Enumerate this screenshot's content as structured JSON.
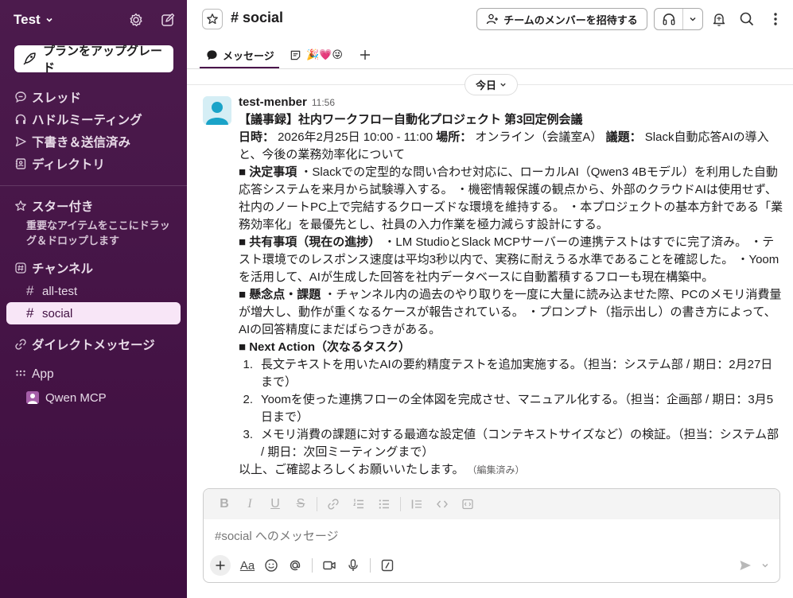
{
  "workspace": {
    "name": "Test",
    "upgrade_label": "プランをアップグレード"
  },
  "sidebar": {
    "nav": [
      {
        "icon": "threads-icon",
        "label": "スレッド"
      },
      {
        "icon": "headphones-icon",
        "label": "ハドルミーティング"
      },
      {
        "icon": "send-icon",
        "label": "下書き＆送信済み"
      },
      {
        "icon": "directory-icon",
        "label": "ディレクトリ"
      }
    ],
    "starred": {
      "label": "スター付き",
      "note": "重要なアイテムをここにドラッグ＆ドロップします"
    },
    "channels": {
      "label": "チャンネル",
      "items": [
        {
          "name": "all-test"
        },
        {
          "name": "social",
          "active": true
        }
      ]
    },
    "dms": {
      "label": "ダイレクトメッセージ"
    },
    "apps": {
      "label": "App",
      "items": [
        {
          "name": "Qwen MCP"
        }
      ]
    }
  },
  "header": {
    "channel": "social",
    "invite_label": "チームのメンバーを招待する",
    "tabs": [
      {
        "label": "メッセージ",
        "active": true
      },
      {
        "label": "🎉💗😜"
      }
    ]
  },
  "date_divider": "今日",
  "message": {
    "author": "test-menber",
    "time": "11:56",
    "title": "【議事録】社内ワークフロー自動化プロジェクト 第3回定例会議",
    "meta": {
      "date_label": "日時：",
      "date_value": " 2026年2月25日 10:00 - 11:00 ",
      "place_label": "場所：",
      "place_value": " オンライン（会議室A） ",
      "topic_label": "議題：",
      "topic_value": " Slack自動応答AIの導入と、今後の業務効率化について"
    },
    "sections": [
      {
        "heading": "■ 決定事項",
        "body": " ・Slackでの定型的な問い合わせ対応に、ローカルAI（Qwen3 4Bモデル）を利用した自動応答システムを来月から試験導入する。 ・機密情報保護の観点から、外部のクラウドAIは使用せず、社内のノートPC上で完結するクローズドな環境を維持する。 ・本プロジェクトの基本方針である「業務効率化」を最優先とし、社員の入力作業を極力減らす設計にする。"
      },
      {
        "heading": "■ 共有事項（現在の進捗）",
        "body": " ・LM StudioとSlack MCPサーバーの連携テストはすでに完了済み。 ・テスト環境でのレスポンス速度は平均3秒以内で、実務に耐えうる水準であることを確認した。 ・Yoomを活用して、AIが生成した回答を社内データベースに自動蓄積するフローも現在構築中。"
      },
      {
        "heading": "■ 懸念点・課題",
        "body": " ・チャンネル内の過去のやり取りを一度に大量に読み込ませた際、PCのメモリ消費量が増大し、動作が重くなるケースが報告されている。 ・プロンプト（指示出し）の書き方によって、AIの回答精度にまだばらつきがある。"
      }
    ],
    "next_action_heading": "■ Next Action（次なるタスク）",
    "next_actions": [
      {
        "num": "1.",
        "text": "長文テキストを用いたAIの要約精度テストを追加実施する。（担当：システム部 / 期日：2月27日まで）"
      },
      {
        "num": "2.",
        "text": "Yoomを使った連携フローの全体図を完成させ、マニュアル化する。（担当：企画部 / 期日：3月5日まで）"
      },
      {
        "num": "3.",
        "text": "メモリ消費の課題に対する最適な設定値（コンテキストサイズなど）の検証。（担当：システム部 / 期日：次回ミーティングまで）"
      }
    ],
    "closing": "以上、ご確認よろしくお願いいたします。",
    "edited": "（編集済み）"
  },
  "composer": {
    "placeholder": "#social へのメッセージ",
    "format_labels": {
      "bold": "B",
      "italic": "I",
      "underline": "U",
      "strike": "S"
    },
    "text_format_label": "Aa"
  },
  "colors": {
    "sidebar": "#4a154b",
    "active_channel_bg": "#f8e6f7",
    "accent": "#4a154b"
  }
}
